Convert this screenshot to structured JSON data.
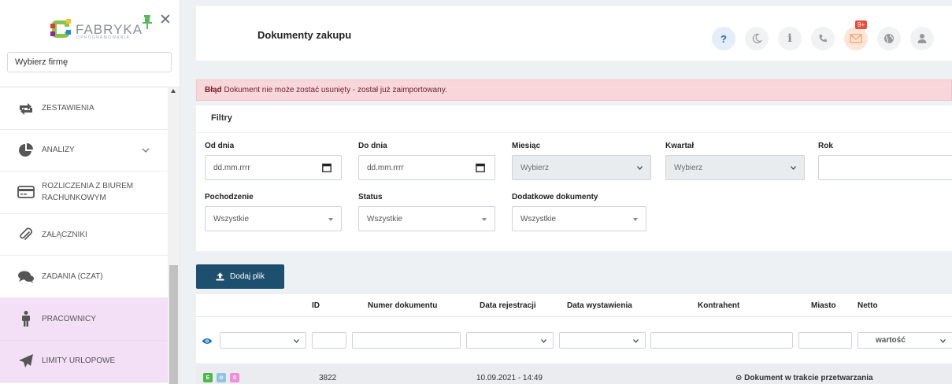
{
  "brand": {
    "name": "FABRYKA",
    "subtitle": "OPROGRAMOWANIA"
  },
  "firm_select": {
    "value": "Wybierz firmę"
  },
  "sidebar": {
    "items": [
      {
        "label": "ZESTAWIENIA",
        "icon": "swap-arrows-icon"
      },
      {
        "label": "ANALIZY",
        "icon": "pie-chart-icon",
        "has_chevron": true
      },
      {
        "label": "ROZLICZENIA Z BIUREM RACHUNKOWYM",
        "icon": "credit-card-icon"
      },
      {
        "label": "ZAŁĄCZNIKI",
        "icon": "paperclip-icon"
      },
      {
        "label": "ZADANIA (CZAT)",
        "icon": "chat-bubbles-icon"
      },
      {
        "label": "PRACOWNICY",
        "icon": "person-icon",
        "active": true
      },
      {
        "label": "LIMITY URLOPOWE",
        "icon": "plane-icon",
        "active": true
      }
    ]
  },
  "header": {
    "title": "Dokumenty zakupu",
    "mail_badge": "9+",
    "help_glyph": "?",
    "info_glyph": "i",
    "icons": [
      "help-icon",
      "moon-icon",
      "info-icon",
      "phone-icon",
      "mail-icon",
      "globe-icon",
      "user-icon"
    ]
  },
  "alert": {
    "title": "Błąd",
    "message": "Dokument nie może zostać usunięty - został już zaimportowany."
  },
  "filters": {
    "title": "Filtry",
    "od_dnia": {
      "label": "Od dnia",
      "placeholder": "dd.mm.rrrr"
    },
    "do_dnia": {
      "label": "Do dnia",
      "placeholder": "dd.mm.rrrr"
    },
    "miesiac": {
      "label": "Miesiąc",
      "value": "Wybierz"
    },
    "kwartal": {
      "label": "Kwartał",
      "value": "Wybierz"
    },
    "rok": {
      "label": "Rok",
      "value": ""
    },
    "pochodzenie": {
      "label": "Pochodzenie",
      "value": "Wszystkie"
    },
    "status": {
      "label": "Status",
      "value": "Wszystkie"
    },
    "dodatkowe": {
      "label": "Dodatkowe dokumenty",
      "value": "Wszystkie"
    }
  },
  "toolbar": {
    "add_label": "Dodaj plik"
  },
  "table": {
    "headers": {
      "id": "ID",
      "numer": "Numer dokumentu",
      "data_rej": "Data rejestracji",
      "data_wyst": "Data wystawienia",
      "kontrahent": "Kontrahent",
      "miasto": "Miasto",
      "netto": "Netto"
    },
    "filter_netto_value": "wartość",
    "rows": [
      {
        "tags": [
          "E",
          "⊙",
          "0"
        ],
        "tag_colors": [
          "#4cb84c",
          "#8fc4e2",
          "#f18fd6"
        ],
        "id": "3822",
        "data_rejestracji": "10.09.2021 - 14:49",
        "status": "Dokument w trakcie przetwarzania"
      }
    ]
  },
  "colors": {
    "sidebar_active": "#f3dff6",
    "primary_button": "#1d4f6e",
    "alert_bg": "#f8d7da",
    "alert_text": "#721c24",
    "badge": "#ea4d3c"
  }
}
